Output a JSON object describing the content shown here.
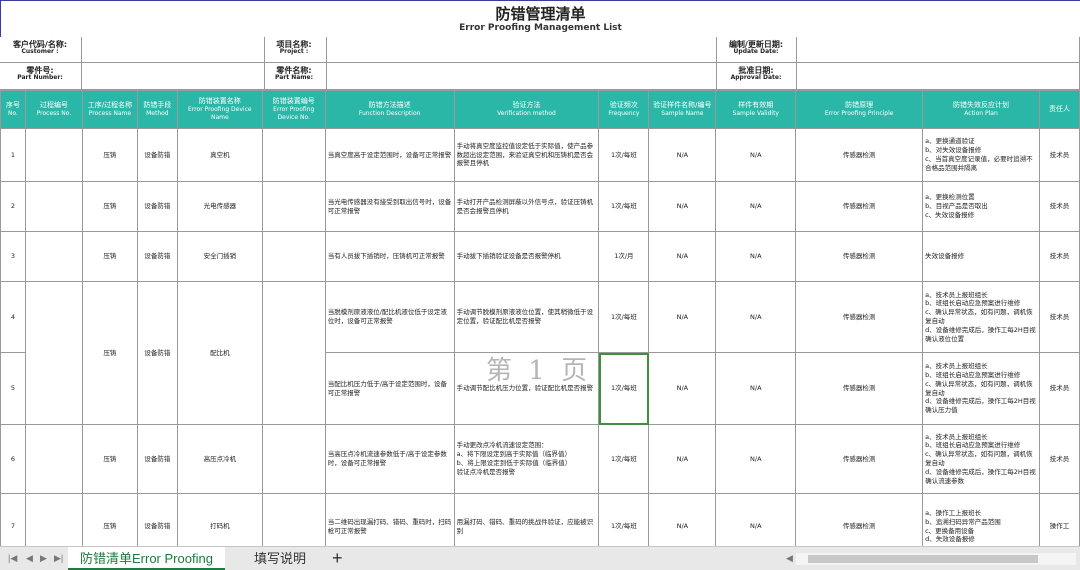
{
  "title": {
    "cn": "防错管理清单",
    "en": "Error Proofing Management List"
  },
  "info": {
    "customer": {
      "cn": "客户代码/名称:",
      "en": "Customer :"
    },
    "part_number": {
      "cn": "零件号:",
      "en": "Part Number:"
    },
    "project": {
      "cn": "项目名称:",
      "en": "Project :"
    },
    "part_name": {
      "cn": "零件名称:",
      "en": "Part Name:"
    },
    "update_date": {
      "cn": "编制/更新日期:",
      "en": "Update Date:"
    },
    "approval_date": {
      "cn": "批准日期:",
      "en": "Approval Date:"
    }
  },
  "headers": [
    {
      "cn": "序号",
      "en": "No."
    },
    {
      "cn": "过程编号",
      "en": "Process No."
    },
    {
      "cn": "工序/过程名称",
      "en": "Process Name"
    },
    {
      "cn": "防错手段",
      "en": "Method"
    },
    {
      "cn": "防错装置名称",
      "en": "Error Proofing Device Name"
    },
    {
      "cn": "防错装置编号",
      "en": "Error Proofing Device No."
    },
    {
      "cn": "防错方法描述",
      "en": "Function Description"
    },
    {
      "cn": "验证方法",
      "en": "Verification method"
    },
    {
      "cn": "验证频次",
      "en": "Frequency"
    },
    {
      "cn": "验证样件名称/编号",
      "en": "Sample Name"
    },
    {
      "cn": "样件有效期",
      "en": "Sample Validity"
    },
    {
      "cn": "防错原理",
      "en": "Error Proofing Principle"
    },
    {
      "cn": "防错失效反应计划",
      "en": "Action Plan"
    },
    {
      "cn": "责任人",
      "en": ""
    }
  ],
  "rows": [
    {
      "no": "1",
      "process_name": "压铸",
      "method": "设备防错",
      "device_name": "真空机",
      "description": "当真空度高于设定范围时，设备可正常报警",
      "verification": "手动将真空度监控值设定低于实际值，使产品参数超出设定范围，来验证真空机和压铸机是否会报警且停机",
      "frequency": "1次/每班",
      "sample": "N/A",
      "validity": "N/A",
      "principle": "传感器检测",
      "action": "a、更换通道验证\nb、对失效设备报修\nc、当首真空度记录值，必要时追溯不合格品范围并隔离",
      "owner": "技术员"
    },
    {
      "no": "2",
      "process_name": "压铸",
      "method": "设备防错",
      "device_name": "光电传感器",
      "description": "当光电传感器没有接受到取出信号时，设备可正常报警",
      "verification": "手动打开产品检测屏蔽以外信号点，验证压铸机是否会报警且停机",
      "frequency": "1次/每班",
      "sample": "N/A",
      "validity": "N/A",
      "principle": "传感器检测",
      "action": "a、更换检测位置\nb、目视产品是否取出\nc、失效设备报修",
      "owner": "技术员"
    },
    {
      "no": "3",
      "process_name": "压铸",
      "method": "设备防错",
      "device_name": "安全门插销",
      "description": "当有人员拔下插销时，压铸机可正常报警",
      "verification": "手动拔下插销验证设备是否报警停机",
      "frequency": "1次/月",
      "sample": "N/A",
      "validity": "N/A",
      "principle": "传感器检测",
      "action": "失效设备报修",
      "owner": "技术员"
    },
    {
      "no": "4",
      "process_name": "压铸",
      "method": "设备防错",
      "device_name": "配比机",
      "description": "当脱模剂原液液位/配比机液位低于设定液位时，设备可正常报警",
      "verification": "手动调节脱模剂原液液位位置，使其稍微低于设定位置，验证配比机是否报警",
      "frequency": "1次/每班",
      "sample": "N/A",
      "validity": "N/A",
      "principle": "传感器检测",
      "action": "a、技术员上报班组长\nb、班组长启动应急预案进行维修\nc、确认异常状态，如有问题，调机恢复自动\nd、设备维修完成后，操作工每2H目视确认液位位置",
      "owner": "技术员"
    },
    {
      "no": "5",
      "description": "当配比机压力低于/高于设定范围时，设备可正常报警",
      "verification": "手动调节配比机压力位置，验证配比机是否报警",
      "frequency": "1次/每班",
      "sample": "N/A",
      "validity": "N/A",
      "principle": "传感器检测",
      "action": "a、技术员上报班组长\nb、班组长启动应急预案进行维修\nc、确认异常状态，如有问题，调机恢复自动\nd、设备维修完成后，操作工每2H目视确认压力值",
      "owner": "技术员"
    },
    {
      "no": "6",
      "process_name": "压铸",
      "method": "设备防错",
      "device_name": "高压点冷机",
      "description": "当高压点冷机流速参数低于/高于设定参数时，设备可正常报警",
      "verification": "手动更改点冷机流速设定范围：\na、将下限设定到高于实际值（临界值）\nb、将上限设定到低于实际值（临界值）\n验证点冷机是否报警",
      "frequency": "1次/每班",
      "sample": "N/A",
      "validity": "N/A",
      "principle": "传感器检测",
      "action": "a、技术员上报班组长\nb、班组长启动应急预案进行维修\nc、确认异常状态，如有问题，调机恢复自动\nd、设备维修完成后，操作工每2H目视确认流速参数",
      "owner": "技术员"
    },
    {
      "no": "7",
      "process_name": "压铸",
      "method": "设备防错",
      "device_name": "打码机",
      "description": "当二维码出现漏打码、错码、重码时，扫码枪可正常报警",
      "verification": "用漏打码、错码、重码的挑战件验证，应能被识别",
      "frequency": "1次/每班",
      "sample": "N/A",
      "validity": "N/A",
      "principle": "传感器检测",
      "action": "a、操作工上报班长\nb、追溯扫码异常产品范围\nc、更换备用设备\nd、失效设备报修",
      "owner": "操作工"
    }
  ],
  "watermark": "第 1 页",
  "tabs": {
    "active": "防错清单Error Proofing",
    "inactive": "填写说明",
    "add": "+"
  },
  "colors": {
    "header_bg": "#2bb7a8",
    "active_tab": "#1e7a3c",
    "selection": "#3f8f3f"
  }
}
